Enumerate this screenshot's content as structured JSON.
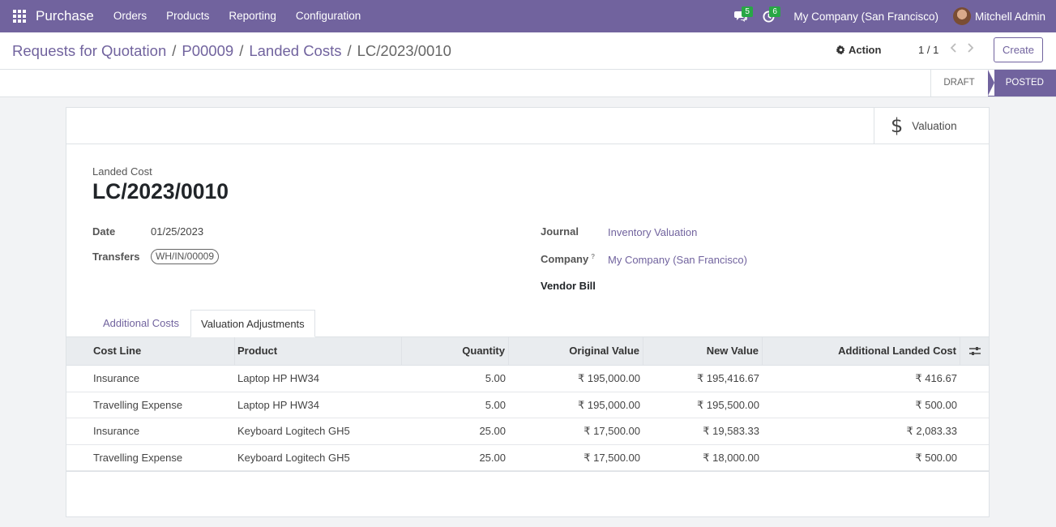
{
  "navbar": {
    "brand": "Purchase",
    "menu": [
      "Orders",
      "Products",
      "Reporting",
      "Configuration"
    ],
    "messages_count": "5",
    "activities_count": "6",
    "company": "My Company (San Francisco)",
    "user": "Mitchell Admin"
  },
  "breadcrumb": {
    "items": [
      "Requests for Quotation",
      "P00009",
      "Landed Costs"
    ],
    "current": "LC/2023/0010"
  },
  "control": {
    "action_label": "Action",
    "pager": "1 / 1",
    "create_label": "Create"
  },
  "status": {
    "draft": "DRAFT",
    "posted": "POSTED"
  },
  "smart_button": {
    "label": "Valuation"
  },
  "record": {
    "title_label": "Landed Cost",
    "name": "LC/2023/0010",
    "date_label": "Date",
    "date": "01/25/2023",
    "transfers_label": "Transfers",
    "transfer_tag": "WH/IN/00009",
    "journal_label": "Journal",
    "journal": "Inventory Valuation",
    "company_label": "Company",
    "company": "My Company (San Francisco)",
    "vendor_bill_label": "Vendor Bill"
  },
  "tabs": {
    "additional_costs": "Additional Costs",
    "valuation_adjustments": "Valuation Adjustments"
  },
  "table": {
    "headers": [
      "Cost Line",
      "Product",
      "Quantity",
      "Original Value",
      "New Value",
      "Additional Landed Cost"
    ],
    "rows": [
      [
        "Insurance",
        "Laptop HP HW34",
        "5.00",
        "₹ 195,000.00",
        "₹ 195,416.67",
        "₹ 416.67"
      ],
      [
        "Travelling Expense",
        "Laptop HP HW34",
        "5.00",
        "₹ 195,000.00",
        "₹ 195,500.00",
        "₹ 500.00"
      ],
      [
        "Insurance",
        "Keyboard Logitech GH5",
        "25.00",
        "₹ 17,500.00",
        "₹ 19,583.33",
        "₹ 2,083.33"
      ],
      [
        "Travelling Expense",
        "Keyboard Logitech GH5",
        "25.00",
        "₹ 17,500.00",
        "₹ 18,000.00",
        "₹ 500.00"
      ]
    ]
  },
  "colors": {
    "brand": "#71639e",
    "badge": "#28a745"
  }
}
